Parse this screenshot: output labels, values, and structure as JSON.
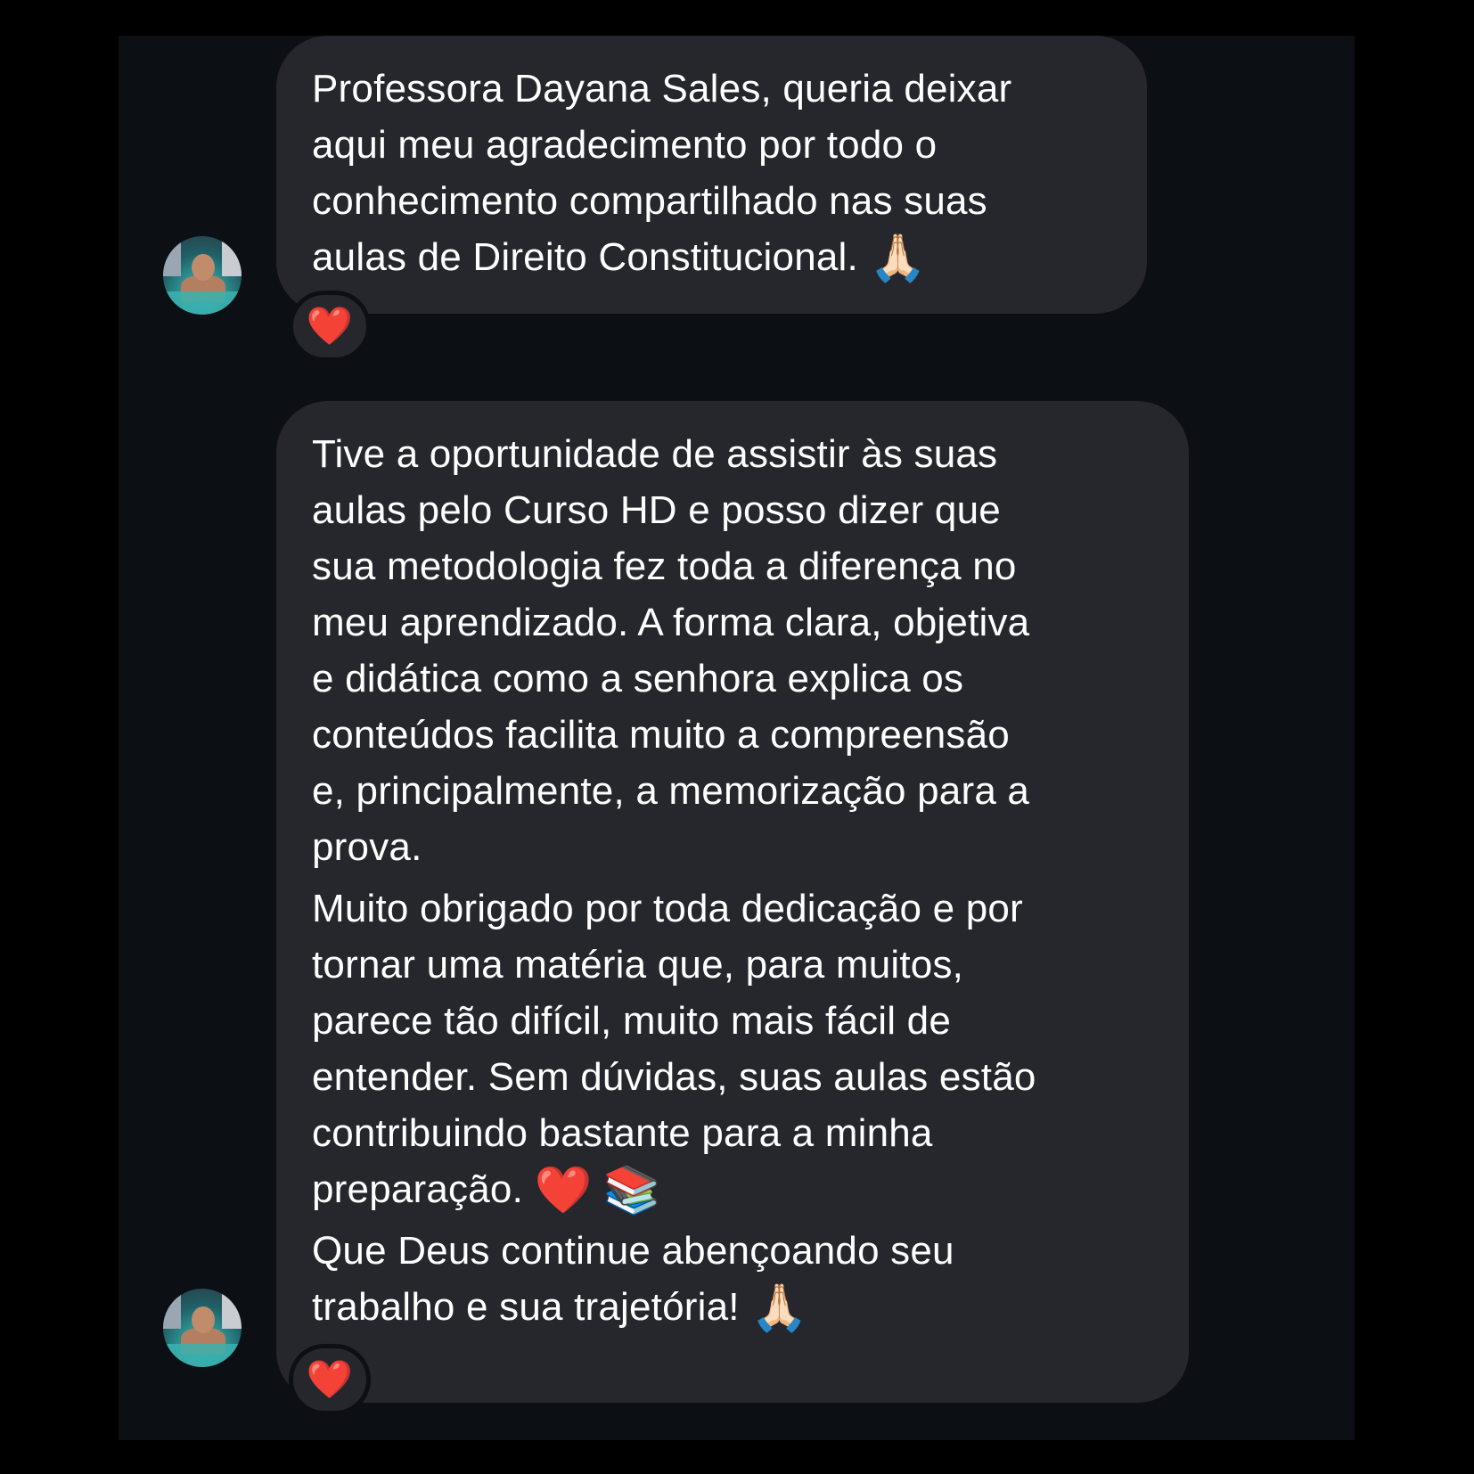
{
  "messages": [
    {
      "paragraphs": [
        {
          "lines": [
            "Professora Dayana Sales, queria deixar",
            "aqui meu agradecimento por todo o",
            "conhecimento compartilhado nas suas",
            "aulas de Direito Constitucional."
          ],
          "end_emojis": [
            "🙏🏻"
          ]
        }
      ],
      "reaction": "❤️"
    },
    {
      "paragraphs": [
        {
          "lines": [
            "Tive a oportunidade de assistir às suas",
            "aulas pelo Curso HD e posso dizer que",
            "sua metodologia fez toda a diferença no",
            "meu aprendizado. A forma clara, objetiva",
            "e didática como a senhora explica os",
            "conteúdos facilita muito a compreensão",
            "e, principalmente, a memorização para a",
            "prova."
          ],
          "end_emojis": []
        },
        {
          "lines": [
            "Muito obrigado por toda dedicação e por",
            "tornar uma matéria que, para muitos,",
            "parece tão difícil, muito mais fácil de",
            "entender. Sem dúvidas, suas aulas estão",
            "contribuindo bastante para a minha",
            "preparação."
          ],
          "end_emojis": [
            "❤️",
            "📚"
          ]
        },
        {
          "lines": [
            "Que Deus continue abençoando seu",
            "trabalho e sua trajetória!"
          ],
          "end_emojis": [
            "🙏🏻"
          ]
        }
      ],
      "reaction": "❤️"
    }
  ],
  "colors": {
    "page_background": "#000000",
    "chat_background": "#0c0f14",
    "bubble_background": "#25272d",
    "text": "#ffffff",
    "heart": "#e0141e"
  },
  "icons": {
    "avatar": "avatar-photo-man-in-pool",
    "reaction": "heart-reaction-icon"
  }
}
